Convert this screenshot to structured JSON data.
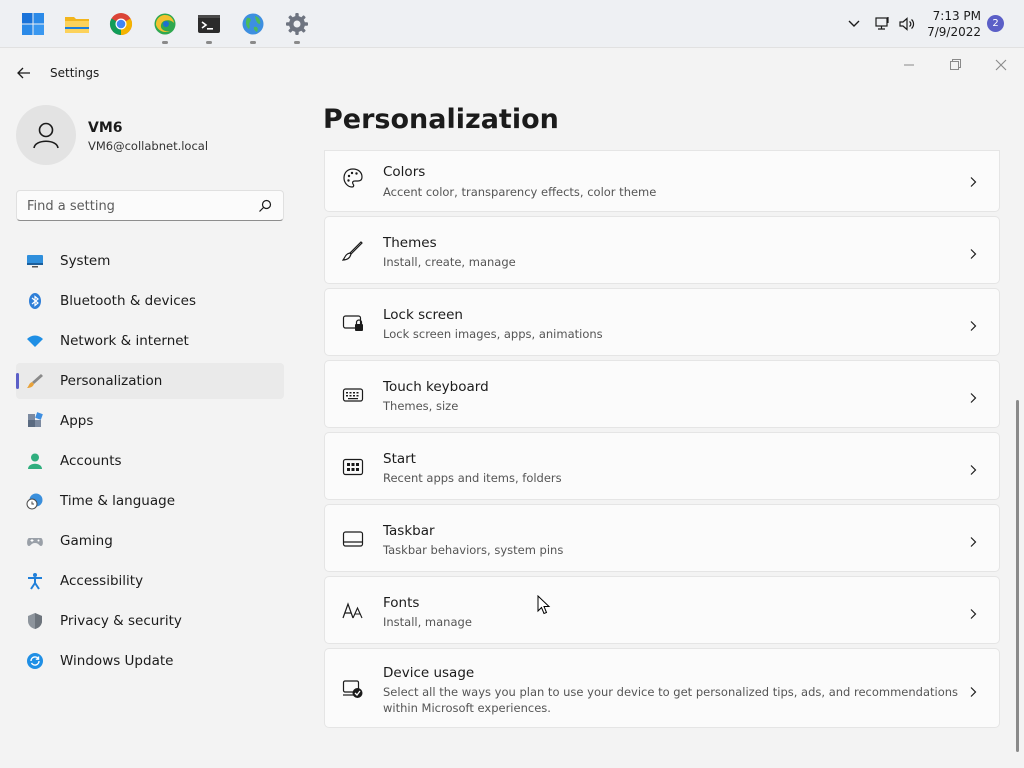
{
  "taskbar": {
    "icons": [
      "windows-start-icon",
      "file-explorer-icon",
      "chrome-icon",
      "edge-canary-icon",
      "terminal-icon",
      "globe-icon",
      "settings-gear-icon"
    ],
    "time": "7:13 PM",
    "date": "7/9/2022",
    "notification_count": "2"
  },
  "window": {
    "title": "Settings"
  },
  "profile": {
    "name": "VM6",
    "email": "VM6@collabnet.local"
  },
  "search": {
    "placeholder": "Find a setting"
  },
  "sidebar": {
    "items": [
      {
        "label": "System",
        "icon": "monitor-icon"
      },
      {
        "label": "Bluetooth & devices",
        "icon": "bluetooth-icon"
      },
      {
        "label": "Network & internet",
        "icon": "wifi-icon"
      },
      {
        "label": "Personalization",
        "icon": "brush-icon",
        "active": true
      },
      {
        "label": "Apps",
        "icon": "apps-icon"
      },
      {
        "label": "Accounts",
        "icon": "person-icon"
      },
      {
        "label": "Time & language",
        "icon": "clock-globe-icon"
      },
      {
        "label": "Gaming",
        "icon": "gamepad-icon"
      },
      {
        "label": "Accessibility",
        "icon": "accessibility-icon"
      },
      {
        "label": "Privacy & security",
        "icon": "shield-icon"
      },
      {
        "label": "Windows Update",
        "icon": "update-icon"
      }
    ]
  },
  "main": {
    "title": "Personalization",
    "cards": [
      {
        "title": "Colors",
        "subtitle": "Accent color, transparency effects, color theme",
        "icon": "palette-icon"
      },
      {
        "title": "Themes",
        "subtitle": "Install, create, manage",
        "icon": "brush-icon"
      },
      {
        "title": "Lock screen",
        "subtitle": "Lock screen images, apps, animations",
        "icon": "lock-screen-icon"
      },
      {
        "title": "Touch keyboard",
        "subtitle": "Themes, size",
        "icon": "keyboard-icon"
      },
      {
        "title": "Start",
        "subtitle": "Recent apps and items, folders",
        "icon": "start-icon"
      },
      {
        "title": "Taskbar",
        "subtitle": "Taskbar behaviors, system pins",
        "icon": "taskbar-icon"
      },
      {
        "title": "Fonts",
        "subtitle": "Install, manage",
        "icon": "fonts-icon"
      },
      {
        "title": "Device usage",
        "subtitle": "Select all the ways you plan to use your device to get personalized tips, ads, and recommendations within Microsoft experiences.",
        "icon": "device-usage-icon"
      }
    ]
  },
  "colors": {
    "accent": "#5b5fc7",
    "background": "#f3f3f3",
    "card": "#fbfbfb"
  }
}
